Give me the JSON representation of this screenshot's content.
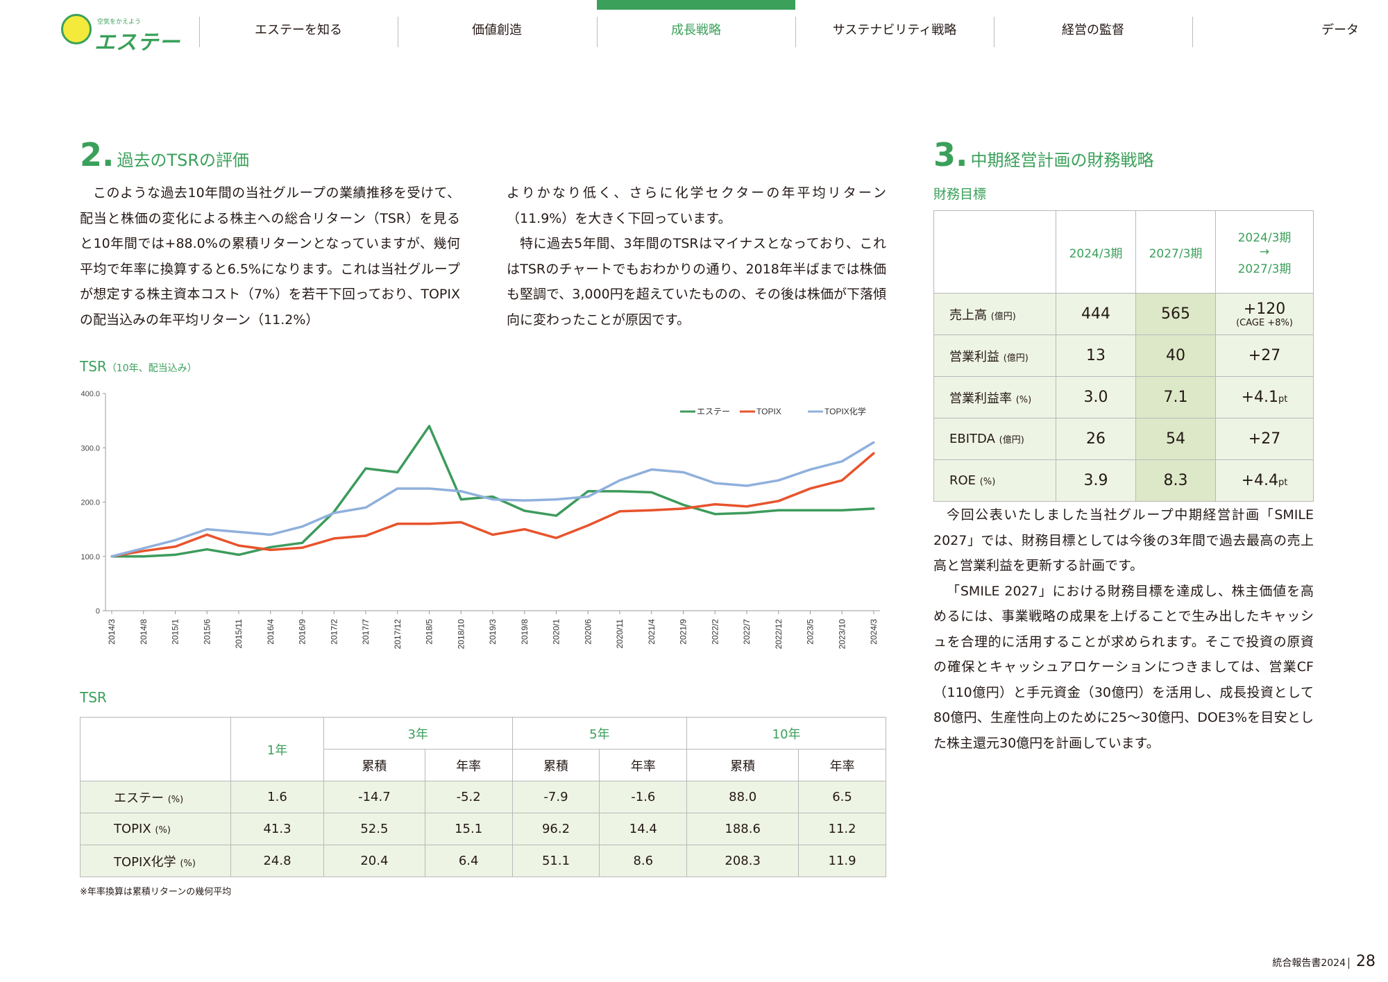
{
  "header": {
    "logo_tagline": "空気をかえよう",
    "logo_name": "エステー",
    "nav": [
      "エステーを知る",
      "価値創造",
      "成長戦略",
      "サステナビリティ戦略",
      "経営の監督",
      "データ"
    ],
    "active_index": 2
  },
  "section2": {
    "num": "2.",
    "title": "過去のTSRの評価",
    "paragraphs_left": [
      "このような過去10年間の当社グループの業績推移を受けて、配当と株価の変化による株主への総合リターン（TSR）を見ると10年間では+88.0%の累積リターンとなっていますが、幾何平均で年率に換算すると6.5%になります。これは当社グループが想定する株主資本コスト（7%）を若干下回っており、TOPIXの配当込みの年平均リターン（11.2%）"
    ],
    "paragraph_right_cont": "よりかなり低く、さらに化学セクターの年平均リターン（11.9%）を大きく下回っています。",
    "paragraph_right": "特に過去5年間、3年間のTSRはマイナスとなっており、これはTSRのチャートでもおわかりの通り、2018年半ばまでは株価も堅調で、3,000円を超えていたものの、その後は株価が下落傾向に変わったことが原因です。"
  },
  "chart_title": "TSR",
  "chart_title_note": "（10年、配当込み）",
  "chart_data": {
    "type": "line",
    "ylim": [
      0,
      400
    ],
    "yticks": [
      "400.0",
      "300.0",
      "200.0",
      "100.0",
      "0"
    ],
    "x": [
      "2014/3",
      "2014/8",
      "2015/1",
      "2015/6",
      "2015/11",
      "2016/4",
      "2016/9",
      "2017/2",
      "2017/7",
      "2017/12",
      "2018/5",
      "2018/10",
      "2019/3",
      "2019/8",
      "2020/1",
      "2020/6",
      "2020/11",
      "2021/4",
      "2021/9",
      "2022/2",
      "2022/7",
      "2022/12",
      "2023/5",
      "2023/10",
      "2024/3"
    ],
    "legend_position": "top-right",
    "series": [
      {
        "name": "エステー",
        "color": "#3d9b5c",
        "values": [
          100,
          100,
          103,
          113,
          103,
          117,
          125,
          182,
          262,
          255,
          340,
          205,
          210,
          184,
          175,
          220,
          220,
          218,
          195,
          178,
          180,
          185,
          185,
          185,
          188
        ]
      },
      {
        "name": "TOPIX",
        "color": "#e8532c",
        "values": [
          100,
          110,
          118,
          140,
          120,
          112,
          116,
          133,
          138,
          160,
          160,
          163,
          140,
          150,
          134,
          157,
          183,
          185,
          188,
          196,
          192,
          202,
          225,
          240,
          290
        ]
      },
      {
        "name": "TOPIX化学",
        "color": "#8fb0dc",
        "values": [
          100,
          115,
          130,
          150,
          145,
          140,
          155,
          180,
          190,
          225,
          225,
          220,
          205,
          203,
          205,
          210,
          240,
          260,
          255,
          235,
          230,
          240,
          260,
          275,
          310
        ]
      }
    ]
  },
  "tsr_table": {
    "title": "TSR",
    "h_1y": "1年",
    "groups": [
      "3年",
      "5年",
      "10年"
    ],
    "sub": [
      "累積",
      "年率"
    ],
    "rows": [
      {
        "label": "エステー",
        "unit": "(%)",
        "cells": [
          "1.6",
          "-14.7",
          "-5.2",
          "-7.9",
          "-1.6",
          "88.0",
          "6.5"
        ]
      },
      {
        "label": "TOPIX",
        "unit": "(%)",
        "cells": [
          "41.3",
          "52.5",
          "15.1",
          "96.2",
          "14.4",
          "188.6",
          "11.2"
        ]
      },
      {
        "label": "TOPIX化学",
        "unit": "(%)",
        "cells": [
          "24.8",
          "20.4",
          "6.4",
          "51.1",
          "8.6",
          "208.3",
          "11.9"
        ]
      }
    ],
    "note": "※年率換算は累積リターンの幾何平均"
  },
  "section3": {
    "num": "3.",
    "title": "中期経営計画の財務戦略",
    "subtitle": "財務目標",
    "table": {
      "h1": "2024/3期",
      "h2": "2027/3期",
      "h3a": "2024/3期",
      "h3b": "→",
      "h3c": "2027/3期",
      "rows": [
        {
          "label": "売上高",
          "unit": "(億円)",
          "a": "444",
          "b": "565",
          "c": "+120",
          "c_note": "(CAGE +8%)"
        },
        {
          "label": "営業利益",
          "unit": "(億円)",
          "a": "13",
          "b": "40",
          "c": "+27"
        },
        {
          "label": "営業利益率",
          "unit": "(%)",
          "a": "3.0",
          "b": "7.1",
          "c": "+4.1",
          "c_suffix": "pt"
        },
        {
          "label": "EBITDA",
          "unit": "(億円)",
          "a": "26",
          "b": "54",
          "c": "+27"
        },
        {
          "label": "ROE",
          "unit": "(%)",
          "a": "3.9",
          "b": "8.3",
          "c": "+4.4",
          "c_suffix": "pt"
        }
      ]
    },
    "paragraphs": [
      "今回公表いたしました当社グループ中期経営計画「SMILE 2027」では、財務目標としては今後の3年間で過去最高の売上高と営業利益を更新する計画です。",
      "「SMILE 2027」における財務目標を達成し、株主価値を高めるには、事業戦略の成果を上げることで生み出したキャッシュを合理的に活用することが求められます。そこで投資の原資の確保とキャッシュアロケーションにつきましては、営業CF（110億円）と手元資金（30億円）を活用し、成長投資として80億円、生産性向上のために25～30億円、DOE3%を目安とした株主還元30億円を計画しています。"
    ]
  },
  "footer": {
    "label": "統合報告書2024",
    "page": "28"
  }
}
